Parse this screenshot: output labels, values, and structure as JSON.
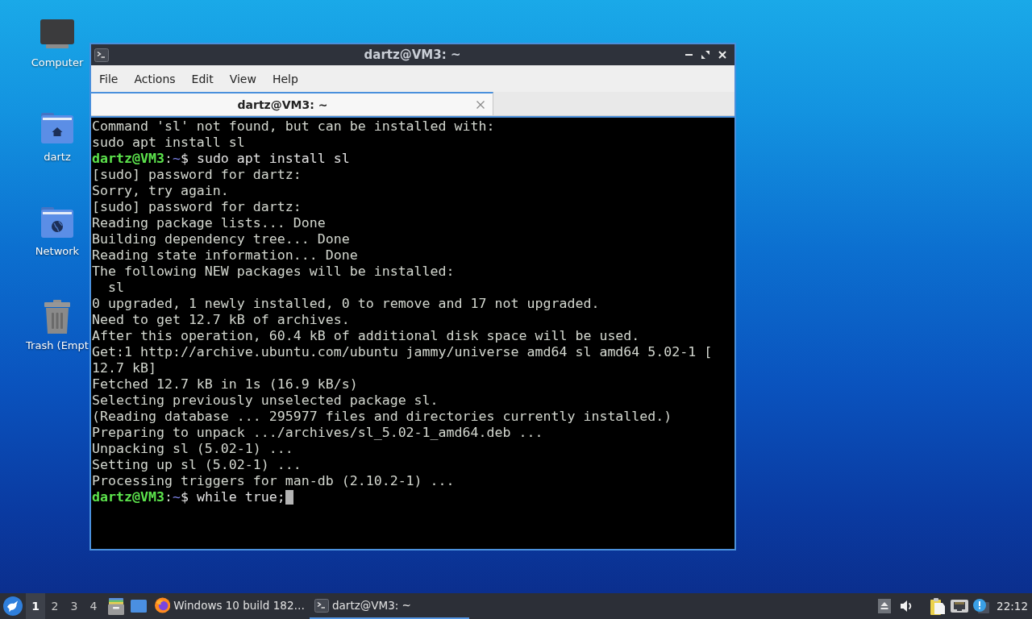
{
  "desktop_icons": [
    {
      "label": "Computer",
      "kind": "computer"
    },
    {
      "label": "dartz",
      "kind": "home-folder"
    },
    {
      "label": "Network",
      "kind": "network-folder"
    },
    {
      "label": "Trash (Empt",
      "kind": "trash"
    }
  ],
  "window": {
    "title": "dartz@VM3: ~",
    "menu": [
      "File",
      "Actions",
      "Edit",
      "View",
      "Help"
    ],
    "tabs": [
      {
        "label": "dartz@VM3: ~",
        "selected": true
      }
    ],
    "terminal": {
      "lines": [
        {
          "kind": "output",
          "text": "Command 'sl' not found, but can be installed with:"
        },
        {
          "kind": "output",
          "text": "sudo apt install sl"
        },
        {
          "kind": "prompt",
          "user": "dartz@VM3",
          "sep": ":",
          "path": "~",
          "command": "$ sudo apt install sl",
          "cursor": false
        },
        {
          "kind": "output",
          "text": "[sudo] password for dartz:"
        },
        {
          "kind": "output",
          "text": "Sorry, try again."
        },
        {
          "kind": "output",
          "text": "[sudo] password for dartz:"
        },
        {
          "kind": "output",
          "text": "Reading package lists... Done"
        },
        {
          "kind": "output",
          "text": "Building dependency tree... Done"
        },
        {
          "kind": "output",
          "text": "Reading state information... Done"
        },
        {
          "kind": "output",
          "text": "The following NEW packages will be installed:"
        },
        {
          "kind": "output",
          "text": "  sl"
        },
        {
          "kind": "output",
          "text": "0 upgraded, 1 newly installed, 0 to remove and 17 not upgraded."
        },
        {
          "kind": "output",
          "text": "Need to get 12.7 kB of archives."
        },
        {
          "kind": "output",
          "text": "After this operation, 60.4 kB of additional disk space will be used."
        },
        {
          "kind": "output",
          "text": "Get:1 http://archive.ubuntu.com/ubuntu jammy/universe amd64 sl amd64 5.02-1 ["
        },
        {
          "kind": "output",
          "text": "12.7 kB]"
        },
        {
          "kind": "output",
          "text": "Fetched 12.7 kB in 1s (16.9 kB/s)"
        },
        {
          "kind": "output",
          "text": "Selecting previously unselected package sl."
        },
        {
          "kind": "output",
          "text": "(Reading database ... 295977 files and directories currently installed.)"
        },
        {
          "kind": "output",
          "text": "Preparing to unpack .../archives/sl_5.02-1_amd64.deb ..."
        },
        {
          "kind": "output",
          "text": "Unpacking sl (5.02-1) ..."
        },
        {
          "kind": "output",
          "text": "Setting up sl (5.02-1) ..."
        },
        {
          "kind": "output",
          "text": "Processing triggers for man-db (2.10.2-1) ..."
        },
        {
          "kind": "prompt",
          "user": "dartz@VM3",
          "sep": ":",
          "path": "~",
          "command": "$ while true;",
          "cursor": true
        }
      ]
    }
  },
  "taskbar": {
    "workspaces": [
      {
        "label": "1",
        "selected": true
      },
      {
        "label": "2",
        "selected": false
      },
      {
        "label": "3",
        "selected": false
      },
      {
        "label": "4",
        "selected": false
      }
    ],
    "tasks": [
      {
        "label": "Windows 10 build 182…",
        "kind": "browser",
        "selected": false
      },
      {
        "label": "dartz@VM3: ~",
        "kind": "terminal",
        "selected": true
      }
    ],
    "clock": "22:12"
  }
}
